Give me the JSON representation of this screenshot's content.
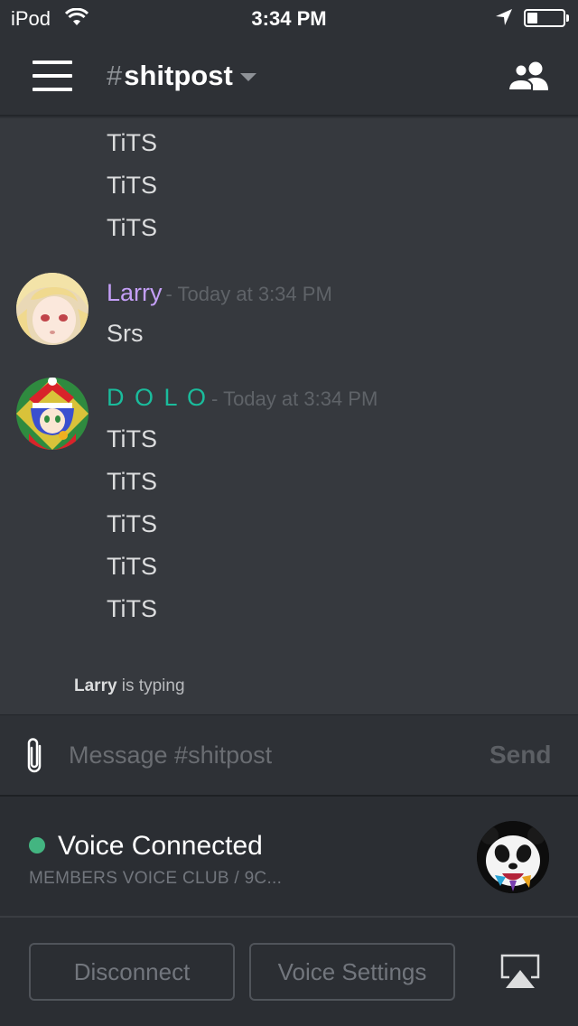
{
  "status_bar": {
    "carrier": "iPod",
    "time": "3:34 PM",
    "battery_level": 0.3
  },
  "header": {
    "channel_hash": "#",
    "channel_name": "shitpost",
    "menu_icon": "hamburger-menu-icon",
    "members_icon": "members-icon"
  },
  "messages": {
    "continued_lines": [
      "TiTS",
      "TiTS",
      "TiTS"
    ],
    "groups": [
      {
        "author": "Larry",
        "author_color": "#c49ff7",
        "timestamp": "- Today at 3:34 PM",
        "lines": [
          "Srs"
        ]
      },
      {
        "author": "D O L O",
        "author_color": "#1abc9c",
        "timestamp": "- Today at 3:34 PM",
        "lines": [
          "TiTS",
          "TiTS",
          "TiTS",
          "TiTS",
          "TiTS"
        ]
      }
    ],
    "typing_user": "Larry",
    "typing_suffix": " is typing"
  },
  "composer": {
    "placeholder": "Message #shitpost",
    "value": "",
    "send_label": "Send"
  },
  "voice": {
    "status": "Voice Connected",
    "status_color": "#43b581",
    "channel": "MEMBERS VOICE CLUB / 9C...",
    "disconnect_label": "Disconnect",
    "settings_label": "Voice Settings"
  }
}
